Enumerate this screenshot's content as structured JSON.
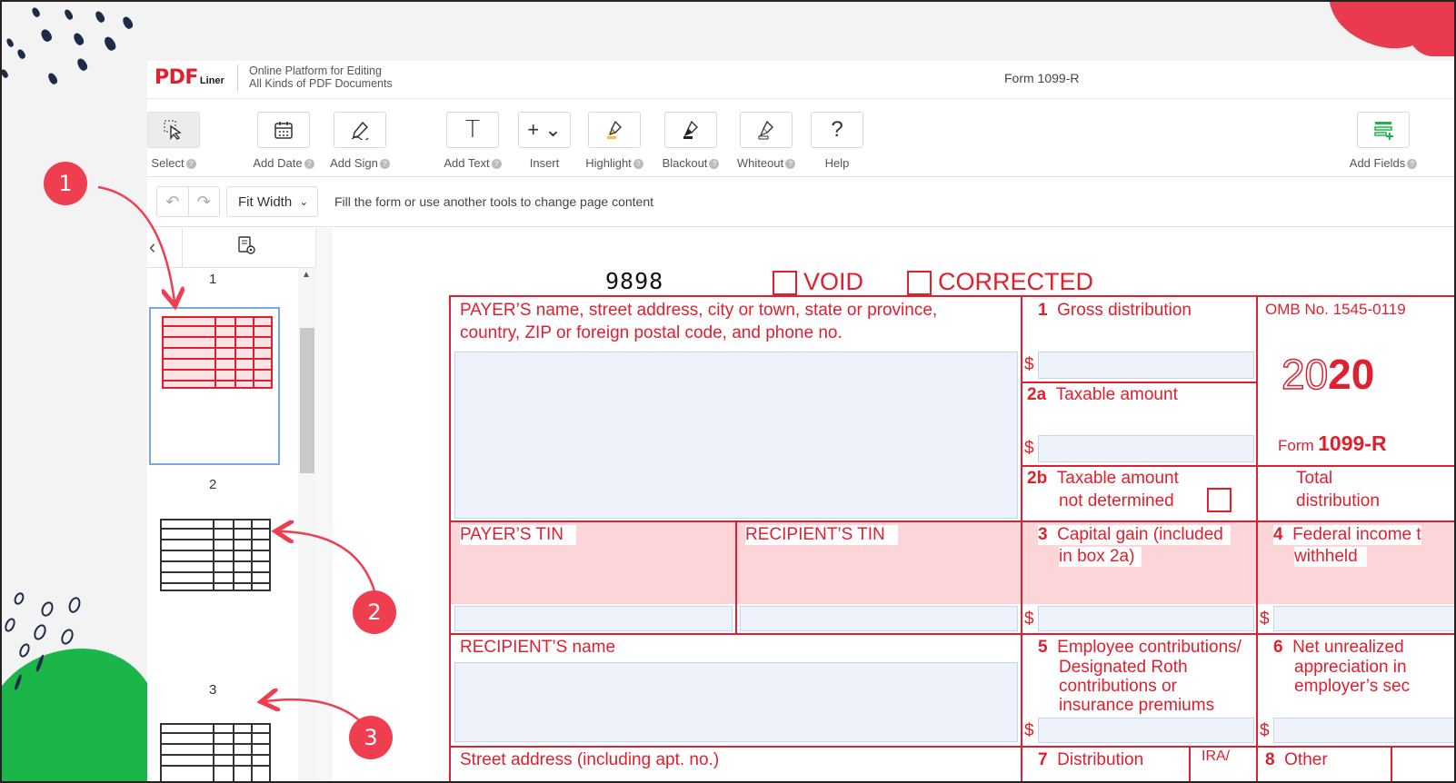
{
  "app": {
    "logo_pdf": "PDF",
    "logo_liner": "Liner",
    "tagline_1": "Online Platform for Editing",
    "tagline_2": "All Kinds of PDF Documents",
    "doc_title": "Form 1099-R"
  },
  "toolbar": {
    "select": "Select",
    "add_date": "Add Date",
    "add_sign": "Add Sign",
    "add_text": "Add Text",
    "insert": "Insert",
    "highlight": "Highlight",
    "blackout": "Blackout",
    "whiteout": "Whiteout",
    "help": "Help",
    "add_fields": "Add Fields",
    "help_glyph": "?",
    "text_glyph": "T",
    "insert_glyph": "+ ⌄"
  },
  "subbar": {
    "zoom": "Fit Width",
    "hint": "Fill the form or use another tools to change page content"
  },
  "sidebar": {
    "pages": [
      "1",
      "2",
      "3"
    ]
  },
  "form": {
    "code": "9898",
    "void": "VOID",
    "corrected": "CORRECTED",
    "payer_label_1": "PAYER’S name, street address, city or town, state or province,",
    "payer_label_2": "country, ZIP or foreign postal code, and phone no.",
    "box1_num": "1",
    "box1_label": "Gross distribution",
    "omb": "OMB No. 1545-0119",
    "year_outline": "20",
    "year_bold": "20",
    "form_word": "Form",
    "form_name": "1099-R",
    "box2a_num": "2a",
    "box2a_label": "Taxable amount",
    "box2b_num": "2b",
    "box2b_label_1": "Taxable amount",
    "box2b_label_2": "not determined",
    "total_1": "Total",
    "total_2": "distribution",
    "payer_tin": "PAYER’S TIN",
    "recipient_tin": "RECIPIENT’S TIN",
    "box3_num": "3",
    "box3_label_1": "Capital gain (included",
    "box3_label_2": "in box 2a)",
    "box4_num": "4",
    "box4_label_1": "Federal income t",
    "box4_label_2": "withheld",
    "recipient_name": "RECIPIENT’S name",
    "box5_num": "5",
    "box5_label_1": "Employee contributions/",
    "box5_label_2": "Designated Roth",
    "box5_label_3": "contributions or",
    "box5_label_4": "insurance premiums",
    "box6_num": "6",
    "box6_label_1": "Net unrealized",
    "box6_label_2": "appreciation in",
    "box6_label_3": "employer’s sec",
    "street": "Street address (including apt. no.)",
    "box7_num": "7",
    "box7_label": "Distribution",
    "ira": "IRA/",
    "box8_num": "8",
    "box8_label": "Other",
    "dollar": "$"
  },
  "annotations": [
    "1",
    "2",
    "3"
  ],
  "colors": {
    "brand_red": "#e0202f",
    "annot_red": "#ef3e4f",
    "green": "#1bb54a",
    "navy": "#1b2b48"
  }
}
